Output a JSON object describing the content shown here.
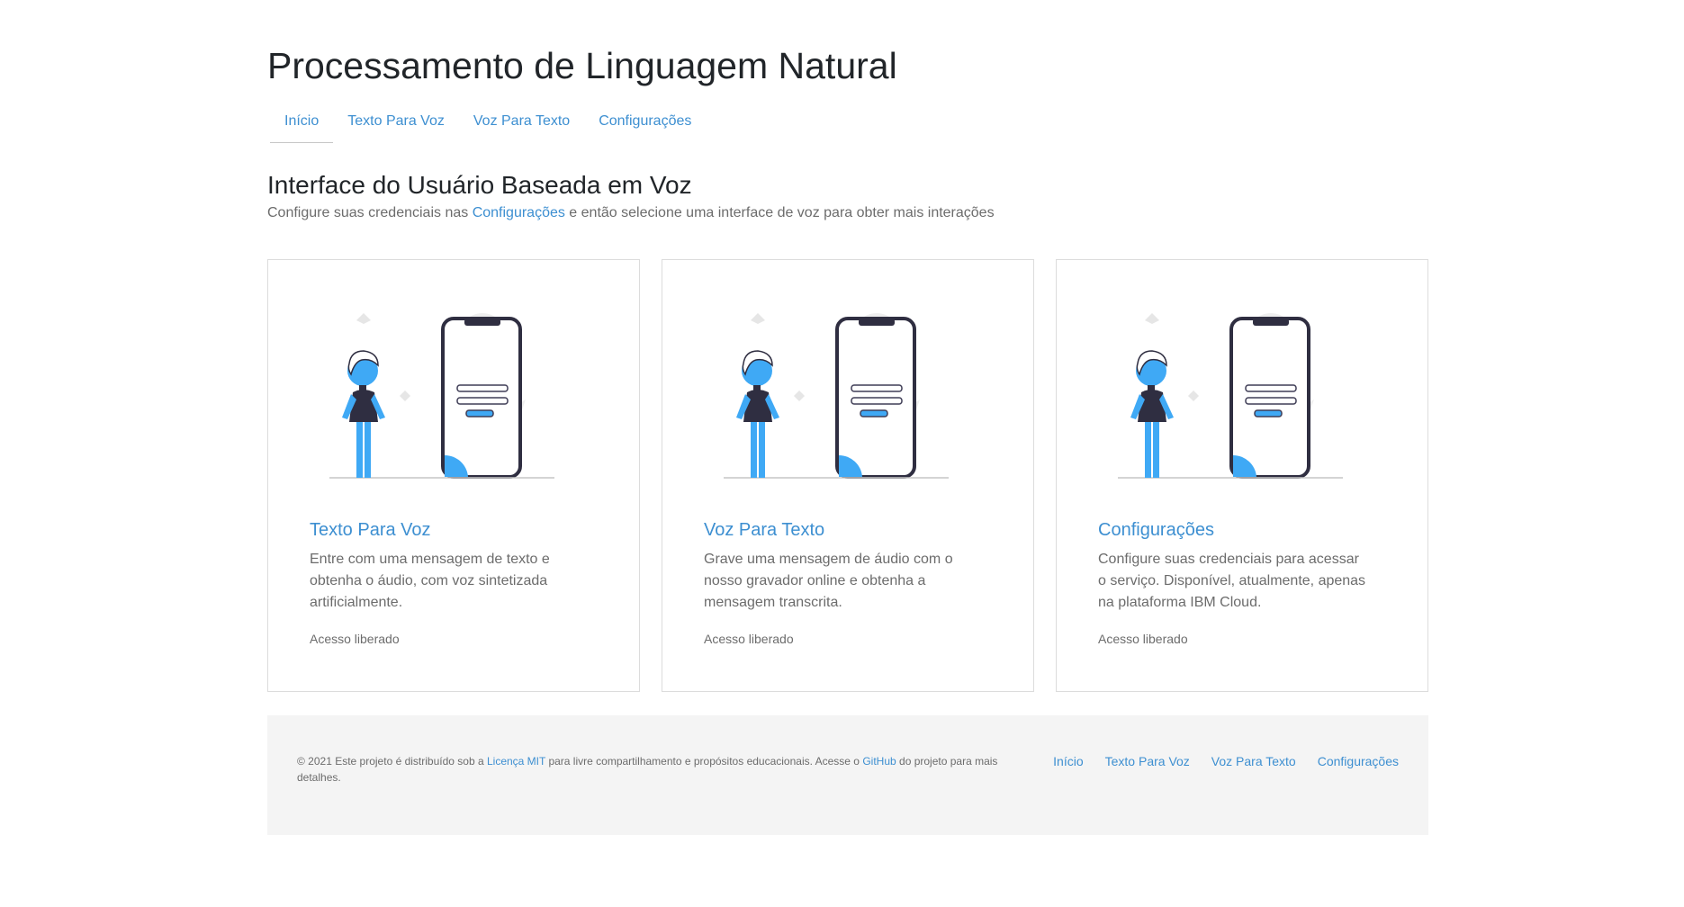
{
  "header": {
    "title": "Processamento de Linguagem Natural"
  },
  "nav": {
    "items": [
      {
        "label": "Início"
      },
      {
        "label": "Texto Para Voz"
      },
      {
        "label": "Voz Para Texto"
      },
      {
        "label": "Configurações"
      }
    ],
    "active": "Início"
  },
  "main": {
    "section_title": "Interface do Usuário Baseada em Voz",
    "lead_before": "Configure suas credenciais nas ",
    "lead_link": "Configurações",
    "lead_after": " e então selecione uma interface de voz para obter mais interações",
    "cards": [
      {
        "title": "Texto Para Voz",
        "text": "Entre com uma mensagem de texto e obtenha o áudio, com voz sintetizada artificialmente.",
        "footer": "Acesso liberado"
      },
      {
        "title": "Voz Para Texto",
        "text": "Grave uma mensagem de áudio com o nosso gravador online e obtenha a mensagem transcrita.",
        "footer": "Acesso liberado"
      },
      {
        "title": "Configurações",
        "text": "Configure suas credenciais para acessar o serviço. Disponível, atualmente, apenas na plataforma IBM Cloud.",
        "footer": "Acesso liberado"
      }
    ]
  },
  "footer": {
    "copy_before": "© 2021 Este projeto é distribuído sob a ",
    "license_link": "Licença MIT",
    "copy_middle": " para livre compartilhamento e propósitos educacionais. Acesse o ",
    "github_link": "GitHub",
    "copy_after": " do projeto para mais detalhes.",
    "nav": [
      {
        "label": "Início"
      },
      {
        "label": "Texto Para Voz"
      },
      {
        "label": "Voz Para Texto"
      },
      {
        "label": "Configurações"
      }
    ]
  },
  "colors": {
    "link": "#3d8fd1",
    "accent_blue": "#3fa9f5",
    "dark": "#2f2e41",
    "muted_text": "#6c6c6c",
    "footer_bg": "#f4f4f4"
  },
  "icons": {
    "card_illustration": "person-with-phone-illustration"
  }
}
